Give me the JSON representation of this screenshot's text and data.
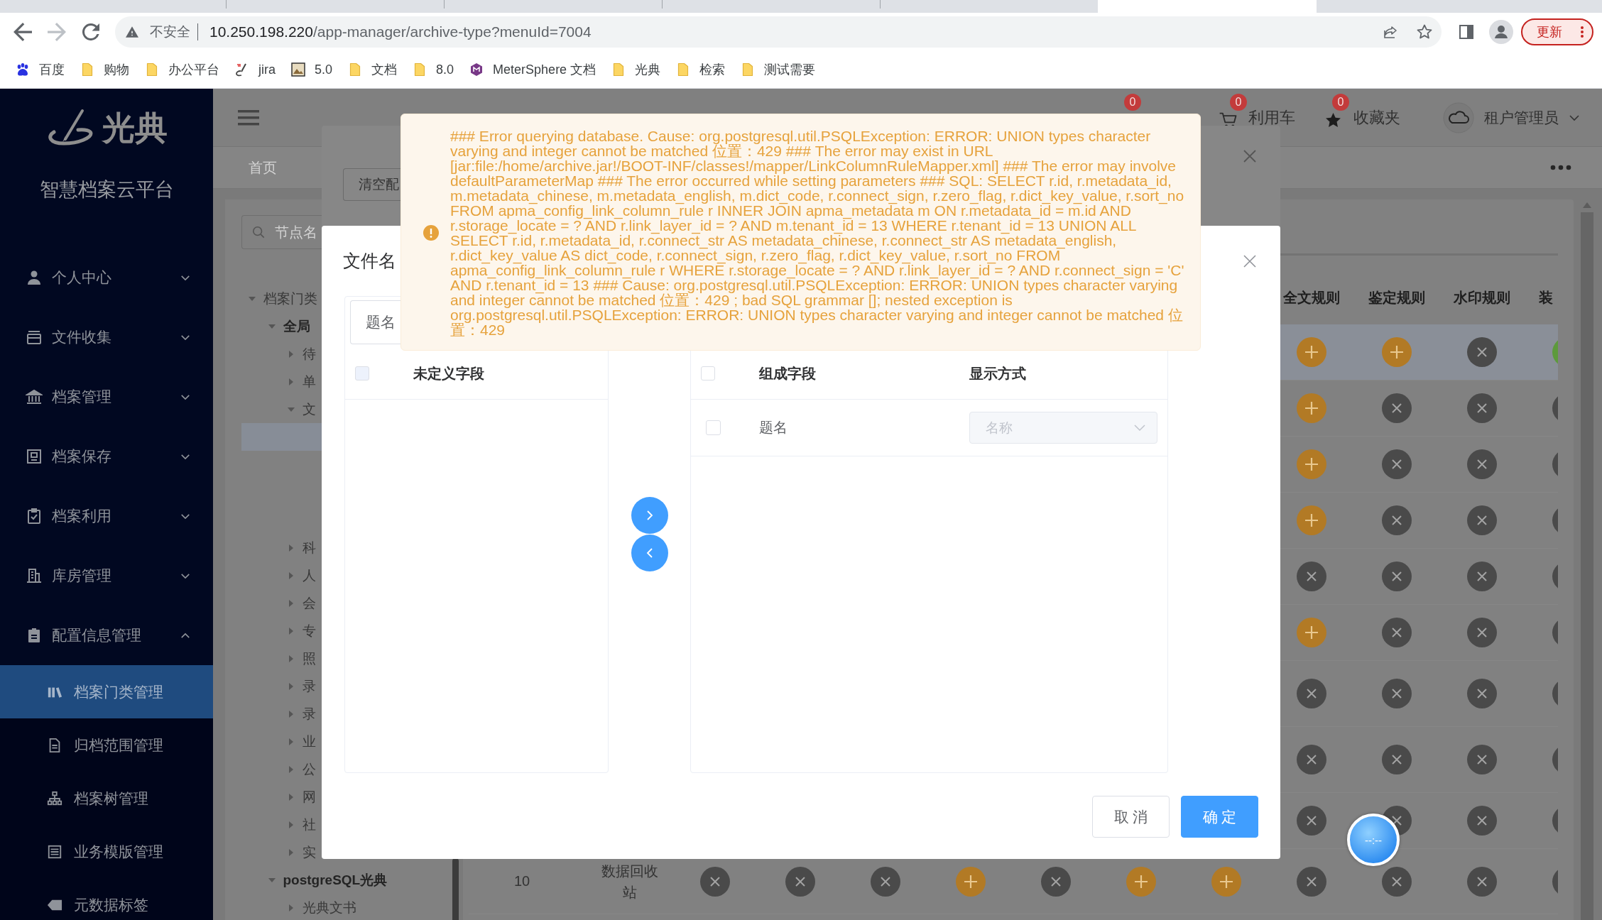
{
  "browser": {
    "address_bar": {
      "security_label": "不安全",
      "url_host": "10.250.198.220",
      "url_path": "/app-manager/archive-type?menuId=7004"
    },
    "update_button": "更新",
    "bookmarks": [
      {
        "label": "百度",
        "kind": "paw"
      },
      {
        "label": "购物",
        "kind": "folder"
      },
      {
        "label": "办公平台",
        "kind": "folder"
      },
      {
        "label": "jira",
        "kind": "brush"
      },
      {
        "label": "5.0",
        "kind": "picture"
      },
      {
        "label": "文档",
        "kind": "folder"
      },
      {
        "label": "8.0",
        "kind": "folder"
      },
      {
        "label": "MeterSphere 文档",
        "kind": "hexagon"
      },
      {
        "label": "光典",
        "kind": "folder"
      },
      {
        "label": "检索",
        "kind": "folder"
      },
      {
        "label": "测试需要",
        "kind": "folder"
      }
    ]
  },
  "sidebar": {
    "logo_text": "光典",
    "platform_name": "智慧档案云平台",
    "menu": [
      {
        "label": "个人中心",
        "expanded": false
      },
      {
        "label": "文件收集",
        "expanded": false
      },
      {
        "label": "档案管理",
        "expanded": false
      },
      {
        "label": "档案保存",
        "expanded": false
      },
      {
        "label": "档案利用",
        "expanded": false
      },
      {
        "label": "库房管理",
        "expanded": false
      },
      {
        "label": "配置信息管理",
        "expanded": true,
        "children": [
          {
            "label": "档案门类管理",
            "selected": true
          },
          {
            "label": "归档范围管理",
            "selected": false
          },
          {
            "label": "档案树管理",
            "selected": false
          },
          {
            "label": "业务模版管理",
            "selected": false
          },
          {
            "label": "元数据标签",
            "selected": false
          }
        ]
      }
    ]
  },
  "header": {
    "shortcuts": [
      {
        "kind": "hidden",
        "badge": "0"
      },
      {
        "kind": "cart",
        "badge": "0",
        "label": "利用车"
      },
      {
        "kind": "star",
        "badge": "0",
        "label": "收藏夹"
      }
    ],
    "user": "租户管理员"
  },
  "tags_bar": {
    "tabs": [
      {
        "label": "首页",
        "selected": false
      }
    ]
  },
  "tree": {
    "search_placeholder": "节点名",
    "nodes": [
      {
        "label": "档案门类",
        "expanded": true,
        "selected": false,
        "children": [
          {
            "label": "全局",
            "expanded": true,
            "selected": false,
            "children": [
              {
                "label": "待",
                "expanded": false,
                "selected": false
              },
              {
                "label": "单",
                "expanded": false,
                "selected": false
              },
              {
                "label": "文",
                "expanded": true,
                "selected": false,
                "children": [
                  {
                    "selected": true
                  }
                ]
              },
              {
                "label": "科",
                "expanded": false,
                "selected": false
              },
              {
                "label": "人",
                "expanded": false,
                "selected": false
              },
              {
                "label": "会",
                "expanded": false,
                "selected": false
              },
              {
                "label": "专",
                "expanded": false,
                "selected": false
              },
              {
                "label": "照",
                "expanded": false,
                "selected": false
              },
              {
                "label": "录",
                "expanded": false,
                "selected": false
              },
              {
                "label": "录",
                "expanded": false,
                "selected": false
              },
              {
                "label": "业",
                "expanded": false,
                "selected": false
              },
              {
                "label": "公",
                "expanded": false,
                "selected": false
              },
              {
                "label": "网",
                "expanded": false,
                "selected": false
              },
              {
                "label": "社",
                "expanded": false,
                "selected": false
              },
              {
                "label": "实",
                "expanded": false,
                "selected": false
              }
            ]
          },
          {
            "label": "postgreSQL光典",
            "expanded": true,
            "selected": false,
            "children": [
              {
                "label": "光典文书",
                "expanded": false,
                "selected": false
              }
            ]
          }
        ]
      }
    ]
  },
  "table": {
    "columns": [
      "全文规则",
      "鉴定规则",
      "水印规则",
      "装"
    ],
    "rows": [
      {
        "selected": true,
        "cells": [
          {
            "kind": "add"
          },
          {
            "kind": "add"
          },
          {
            "kind": "remove"
          },
          {
            "kind": "done"
          }
        ]
      },
      {
        "selected": false,
        "cells": [
          {
            "kind": "add"
          },
          {
            "kind": "remove"
          },
          {
            "kind": "remove"
          },
          {
            "kind": "remove"
          }
        ]
      },
      {
        "selected": false,
        "cells": [
          {
            "kind": "add"
          },
          {
            "kind": "remove"
          },
          {
            "kind": "remove"
          },
          {
            "kind": "remove"
          }
        ]
      },
      {
        "selected": false,
        "cells": [
          {
            "kind": "add"
          },
          {
            "kind": "remove"
          },
          {
            "kind": "remove"
          },
          {
            "kind": "remove"
          }
        ]
      },
      {
        "selected": false,
        "cells": [
          {
            "kind": "remove"
          },
          {
            "kind": "remove"
          },
          {
            "kind": "remove"
          },
          {
            "kind": "remove"
          }
        ]
      },
      {
        "selected": false,
        "cells": [
          {
            "kind": "add"
          },
          {
            "kind": "remove"
          },
          {
            "kind": "remove"
          },
          {
            "kind": "remove"
          }
        ]
      },
      {
        "selected": false,
        "cells": [
          {
            "kind": "remove"
          },
          {
            "kind": "remove"
          },
          {
            "kind": "remove"
          },
          {
            "kind": "remove"
          }
        ]
      },
      {
        "selected": false,
        "cells": [
          {
            "kind": "remove"
          },
          {
            "kind": "remove"
          },
          {
            "kind": "remove"
          },
          {
            "kind": "remove"
          }
        ]
      },
      {
        "selected": false,
        "cells": [
          {
            "kind": "remove"
          },
          {
            "kind": "remove"
          },
          {
            "kind": "remove"
          },
          {
            "kind": "remove"
          }
        ]
      },
      {
        "selected": false,
        "index": "10",
        "name": "数据回收站",
        "cells": [
          {
            "kind": "remove"
          },
          {
            "kind": "remove"
          },
          {
            "kind": "remove"
          },
          {
            "kind": "add"
          },
          {
            "kind": "remove"
          },
          {
            "kind": "add"
          },
          {
            "kind": "add"
          },
          {
            "kind": "remove"
          },
          {
            "kind": "remove"
          },
          {
            "kind": "remove"
          },
          {
            "kind": "remove"
          }
        ]
      }
    ]
  },
  "background_dialog": {
    "clear_button": "清空配"
  },
  "dialog": {
    "title": "文件名",
    "search_value": "题名",
    "left_panel": {
      "title": "未定义字段",
      "checked": false,
      "disabled": true
    },
    "right_panel": {
      "columns": [
        "组成字段",
        "显示方式"
      ],
      "checked": false,
      "disabled": false,
      "rows": [
        {
          "field": "题名",
          "checked": false,
          "display_placeholder": "名称",
          "display_disabled": true
        }
      ]
    },
    "buttons": [
      {
        "label": "取 消",
        "kind": "default"
      },
      {
        "label": "确 定",
        "kind": "primary"
      }
    ]
  },
  "message": {
    "kind": "warning",
    "text": "### Error querying database. Cause: org.postgresql.util.PSQLException: ERROR: UNION types character varying and integer cannot be matched 位置：429 ### The error may exist in URL [jar:file:/home/archive.jar!/BOOT-INF/classes!/mapper/LinkColumnRuleMapper.xml] ### The error may involve defaultParameterMap ### The error occurred while setting parameters ### SQL: SELECT r.id, r.metadata_id, m.metadata_chinese, m.metadata_english, m.dict_code, r.connect_sign, r.zero_flag, r.dict_key_value, r.sort_no FROM apma_config_link_column_rule r INNER JOIN apma_metadata m ON r.metadata_id = m.id AND r.storage_locate = ? AND r.link_layer_id = ? AND m.tenant_id = 13 WHERE r.tenant_id = 13 UNION ALL SELECT r.id, r.metadata_id, r.connect_str AS metadata_chinese, r.connect_str AS metadata_english, r.dict_key_value AS dict_code, r.connect_sign, r.zero_flag, r.dict_key_value, r.sort_no FROM apma_config_link_column_rule r WHERE r.storage_locate = ? AND r.link_layer_id = ? AND r.connect_sign = 'C' AND r.tenant_id = 13 ### Cause: org.postgresql.util.PSQLException: ERROR: UNION types character varying and integer cannot be matched 位置：429 ; bad SQL grammar []; nested exception is org.postgresql.util.PSQLException: ERROR: UNION types character varying and integer cannot be matched 位置：429"
  },
  "floating_clock": {
    "text": "--:--"
  }
}
